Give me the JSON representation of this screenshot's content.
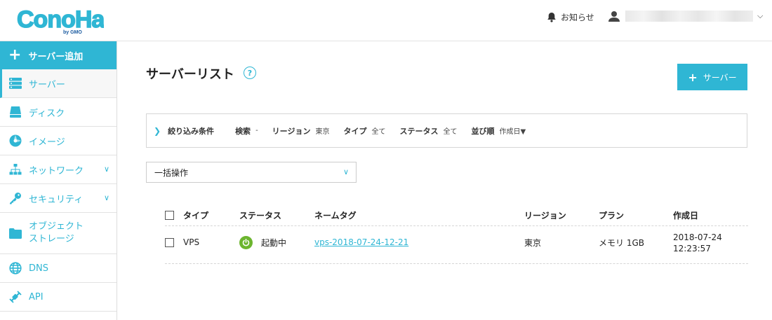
{
  "header": {
    "logo_text": "ConoHa",
    "logo_sub": "by GMO",
    "notice_label": "お知らせ",
    "brand_color": "#2fb6d4"
  },
  "sidebar": {
    "add_label": "サーバー追加",
    "items": [
      {
        "label": "サーバー",
        "icon": "server-icon",
        "active": true
      },
      {
        "label": "ディスク",
        "icon": "disk-icon"
      },
      {
        "label": "イメージ",
        "icon": "image-icon"
      },
      {
        "label": "ネットワーク",
        "icon": "network-icon",
        "expandable": true
      },
      {
        "label": "セキュリティ",
        "icon": "key-icon",
        "expandable": true
      },
      {
        "label": "オブジェクト\nストレージ",
        "label_line1": "オブジェクト",
        "label_line2": "ストレージ",
        "icon": "folder-icon"
      },
      {
        "label": "DNS",
        "icon": "globe-icon"
      },
      {
        "label": "API",
        "icon": "api-icon"
      }
    ]
  },
  "main": {
    "title": "サーバーリスト",
    "help": "?",
    "add_button_label": "サーバー",
    "filter": {
      "title": "絞り込み条件",
      "search_label": "検索",
      "search_value": "-",
      "region_label": "リージョン",
      "region_value": "東京",
      "type_label": "タイプ",
      "type_value": "全て",
      "status_label": "ステータス",
      "status_value": "全て",
      "sort_label": "並び順",
      "sort_value": "作成日▼"
    },
    "bulk_action": {
      "selected": "一括操作"
    },
    "table": {
      "headers": [
        "タイプ",
        "ステータス",
        "ネームタグ",
        "リージョン",
        "プラン",
        "作成日"
      ],
      "rows": [
        {
          "type": "VPS",
          "status": "起動中",
          "status_color": "#6cb52f",
          "name_tag": "vps-2018-07-24-12-21",
          "region": "東京",
          "plan": "メモリ 1GB",
          "created_date": "2018-07-24",
          "created_time": "12:23:57"
        }
      ]
    }
  }
}
